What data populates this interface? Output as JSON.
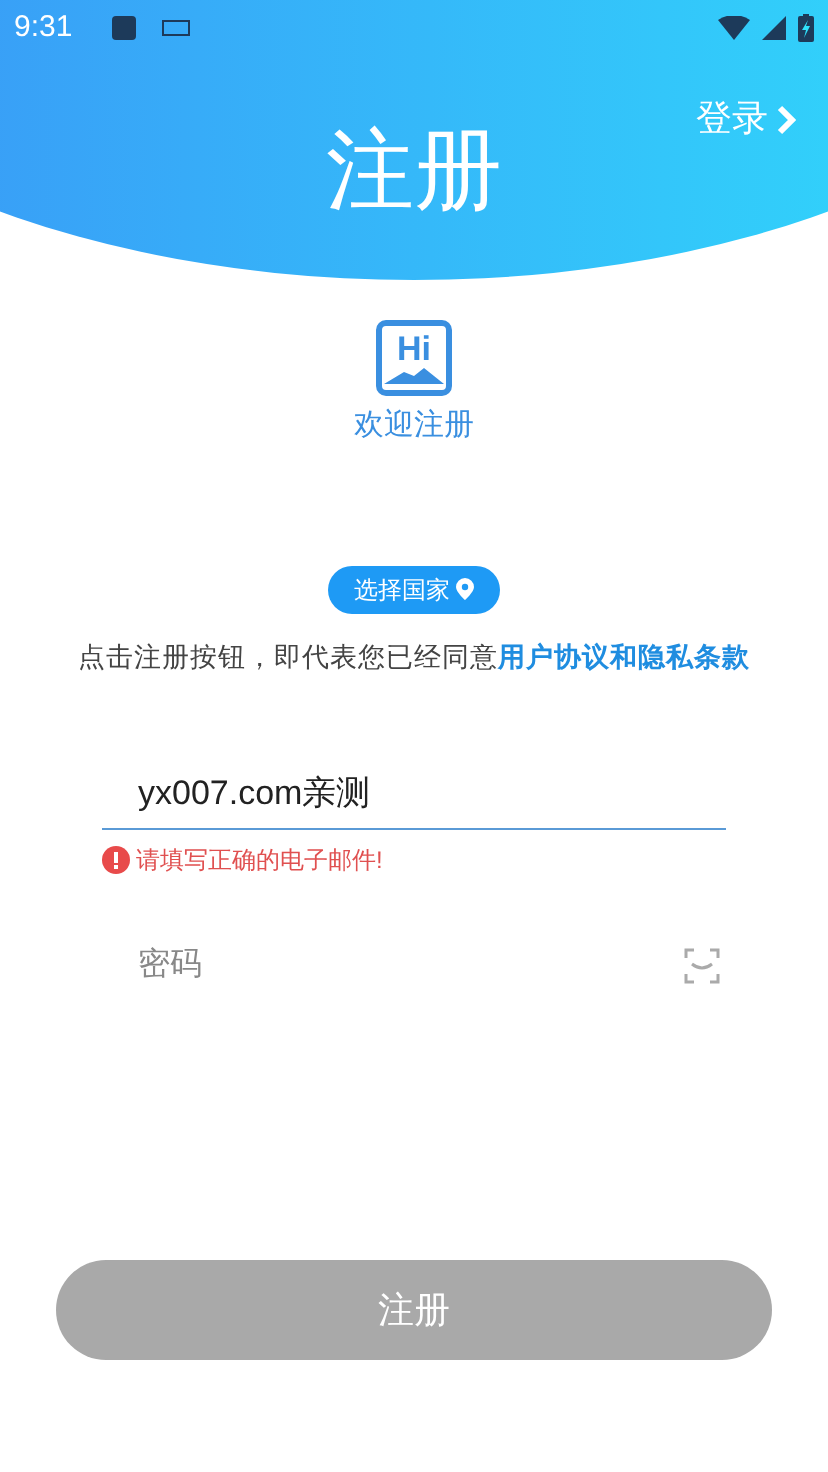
{
  "status_bar": {
    "time": "9:31"
  },
  "header": {
    "title": "注册",
    "login_link": "登录"
  },
  "welcome": {
    "logo_text": "Hi",
    "caption": "欢迎注册"
  },
  "country_button": {
    "label": "选择国家"
  },
  "agreement": {
    "text": "点击注册按钮，即代表您已经同意",
    "link": "用户协议和隐私条款"
  },
  "email_field": {
    "value": "yx007.com亲测",
    "error": "请填写正确的电子邮件!"
  },
  "password_field": {
    "placeholder": "密码"
  },
  "submit_button": {
    "label": "注册",
    "disabled": true
  }
}
